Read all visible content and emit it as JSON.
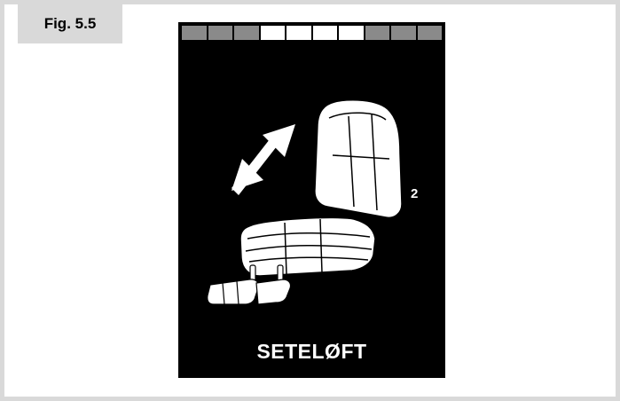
{
  "figure": {
    "label": "Fig. 5.5"
  },
  "display": {
    "seat_position_number": "2",
    "mode_label": "SETELØFT",
    "level_bar": {
      "segments": [
        false,
        false,
        false,
        true,
        true,
        true,
        true,
        false,
        false,
        false
      ],
      "active_color": "#ffffff",
      "inactive_color": "#8a8a8a"
    },
    "icons": [
      "up-down-arrow-icon",
      "seat-backrest-icon",
      "seat-cushion-icon",
      "footrest-icon"
    ]
  }
}
